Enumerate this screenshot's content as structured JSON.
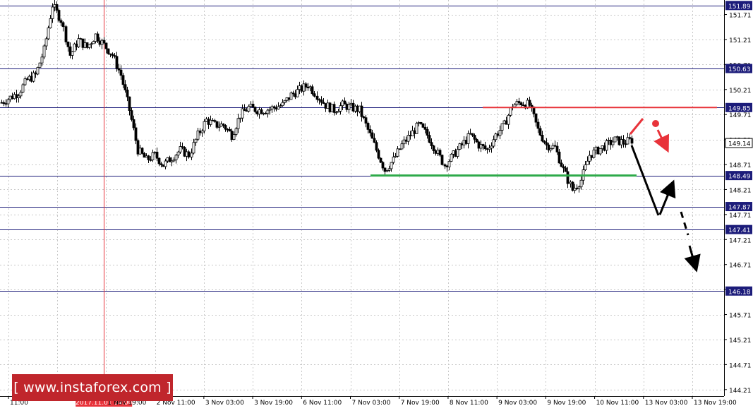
{
  "chart_data": {
    "type": "candlestick",
    "ylim": [
      144.08,
      152.0
    ],
    "grid": true,
    "y_tick_labels": [
      "151.71",
      "151.21",
      "150.71",
      "150.21",
      "149.71",
      "149.21",
      "148.71",
      "148.21",
      "147.71",
      "147.21",
      "146.71",
      "146.21",
      "145.71",
      "145.21",
      "144.71",
      "144.21"
    ],
    "x_tick_labels": [
      "11:00",
      "2017.11.01 14:00",
      "1 Nov 19:00",
      "2 Nov 11:00",
      "3 Nov 03:00",
      "3 Nov 19:00",
      "6 Nov 11:00",
      "7 Nov 03:00",
      "7 Nov 19:00",
      "8 Nov 11:00",
      "9 Nov 03:00",
      "9 Nov 19:00",
      "10 Nov 11:00",
      "13 Nov 03:00",
      "13 Nov 19:00"
    ],
    "horizontal_levels": [
      {
        "value": 151.89,
        "label": "151.89"
      },
      {
        "value": 150.63,
        "label": "150.63"
      },
      {
        "value": 149.85,
        "label": "149.85"
      },
      {
        "value": 148.49,
        "label": "148.49"
      },
      {
        "value": 147.87,
        "label": "147.87"
      },
      {
        "value": 147.41,
        "label": "147.41"
      },
      {
        "value": 146.18,
        "label": "146.18"
      }
    ],
    "current_price": {
      "value": 149.14,
      "label": "149.14"
    },
    "resistance": {
      "value": 149.85,
      "color": "#e8333a"
    },
    "support": {
      "value": 148.49,
      "color": "#2eaa4a"
    },
    "close_path": [
      149.95,
      150.05,
      150.15,
      150.4,
      150.5,
      151.0,
      151.9,
      151.6,
      150.9,
      151.2,
      151.05,
      151.3,
      151.1,
      150.9,
      150.5,
      149.8,
      149.0,
      148.8,
      148.9,
      148.7,
      148.85,
      149.0,
      148.9,
      149.3,
      149.6,
      149.5,
      149.5,
      149.3,
      149.7,
      149.85,
      149.8,
      149.8,
      149.85,
      149.9,
      150.1,
      150.2,
      150.3,
      150.1,
      149.9,
      149.8,
      149.9,
      149.85,
      149.8,
      149.4,
      149.0,
      148.6,
      148.8,
      149.1,
      149.3,
      149.5,
      149.3,
      149.0,
      148.7,
      148.9,
      149.1,
      149.3,
      149.1,
      149.0,
      149.3,
      149.5,
      149.9,
      149.95,
      149.9,
      149.4,
      149.1,
      149.05,
      148.6,
      148.2,
      148.4,
      148.9,
      149.0,
      149.1,
      149.2,
      149.15,
      149.2
    ]
  },
  "watermark": {
    "text": "[ www.instaforex.com ]"
  }
}
